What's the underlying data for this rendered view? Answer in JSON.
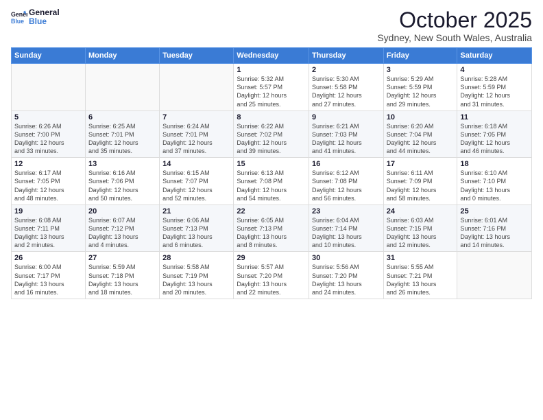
{
  "logo": {
    "line1": "General",
    "line2": "Blue"
  },
  "title": "October 2025",
  "subtitle": "Sydney, New South Wales, Australia",
  "days_of_week": [
    "Sunday",
    "Monday",
    "Tuesday",
    "Wednesday",
    "Thursday",
    "Friday",
    "Saturday"
  ],
  "weeks": [
    [
      {
        "day": "",
        "info": ""
      },
      {
        "day": "",
        "info": ""
      },
      {
        "day": "",
        "info": ""
      },
      {
        "day": "1",
        "info": "Sunrise: 5:32 AM\nSunset: 5:57 PM\nDaylight: 12 hours\nand 25 minutes."
      },
      {
        "day": "2",
        "info": "Sunrise: 5:30 AM\nSunset: 5:58 PM\nDaylight: 12 hours\nand 27 minutes."
      },
      {
        "day": "3",
        "info": "Sunrise: 5:29 AM\nSunset: 5:59 PM\nDaylight: 12 hours\nand 29 minutes."
      },
      {
        "day": "4",
        "info": "Sunrise: 5:28 AM\nSunset: 5:59 PM\nDaylight: 12 hours\nand 31 minutes."
      }
    ],
    [
      {
        "day": "5",
        "info": "Sunrise: 6:26 AM\nSunset: 7:00 PM\nDaylight: 12 hours\nand 33 minutes."
      },
      {
        "day": "6",
        "info": "Sunrise: 6:25 AM\nSunset: 7:01 PM\nDaylight: 12 hours\nand 35 minutes."
      },
      {
        "day": "7",
        "info": "Sunrise: 6:24 AM\nSunset: 7:01 PM\nDaylight: 12 hours\nand 37 minutes."
      },
      {
        "day": "8",
        "info": "Sunrise: 6:22 AM\nSunset: 7:02 PM\nDaylight: 12 hours\nand 39 minutes."
      },
      {
        "day": "9",
        "info": "Sunrise: 6:21 AM\nSunset: 7:03 PM\nDaylight: 12 hours\nand 41 minutes."
      },
      {
        "day": "10",
        "info": "Sunrise: 6:20 AM\nSunset: 7:04 PM\nDaylight: 12 hours\nand 44 minutes."
      },
      {
        "day": "11",
        "info": "Sunrise: 6:18 AM\nSunset: 7:05 PM\nDaylight: 12 hours\nand 46 minutes."
      }
    ],
    [
      {
        "day": "12",
        "info": "Sunrise: 6:17 AM\nSunset: 7:05 PM\nDaylight: 12 hours\nand 48 minutes."
      },
      {
        "day": "13",
        "info": "Sunrise: 6:16 AM\nSunset: 7:06 PM\nDaylight: 12 hours\nand 50 minutes."
      },
      {
        "day": "14",
        "info": "Sunrise: 6:15 AM\nSunset: 7:07 PM\nDaylight: 12 hours\nand 52 minutes."
      },
      {
        "day": "15",
        "info": "Sunrise: 6:13 AM\nSunset: 7:08 PM\nDaylight: 12 hours\nand 54 minutes."
      },
      {
        "day": "16",
        "info": "Sunrise: 6:12 AM\nSunset: 7:08 PM\nDaylight: 12 hours\nand 56 minutes."
      },
      {
        "day": "17",
        "info": "Sunrise: 6:11 AM\nSunset: 7:09 PM\nDaylight: 12 hours\nand 58 minutes."
      },
      {
        "day": "18",
        "info": "Sunrise: 6:10 AM\nSunset: 7:10 PM\nDaylight: 13 hours\nand 0 minutes."
      }
    ],
    [
      {
        "day": "19",
        "info": "Sunrise: 6:08 AM\nSunset: 7:11 PM\nDaylight: 13 hours\nand 2 minutes."
      },
      {
        "day": "20",
        "info": "Sunrise: 6:07 AM\nSunset: 7:12 PM\nDaylight: 13 hours\nand 4 minutes."
      },
      {
        "day": "21",
        "info": "Sunrise: 6:06 AM\nSunset: 7:13 PM\nDaylight: 13 hours\nand 6 minutes."
      },
      {
        "day": "22",
        "info": "Sunrise: 6:05 AM\nSunset: 7:13 PM\nDaylight: 13 hours\nand 8 minutes."
      },
      {
        "day": "23",
        "info": "Sunrise: 6:04 AM\nSunset: 7:14 PM\nDaylight: 13 hours\nand 10 minutes."
      },
      {
        "day": "24",
        "info": "Sunrise: 6:03 AM\nSunset: 7:15 PM\nDaylight: 13 hours\nand 12 minutes."
      },
      {
        "day": "25",
        "info": "Sunrise: 6:01 AM\nSunset: 7:16 PM\nDaylight: 13 hours\nand 14 minutes."
      }
    ],
    [
      {
        "day": "26",
        "info": "Sunrise: 6:00 AM\nSunset: 7:17 PM\nDaylight: 13 hours\nand 16 minutes."
      },
      {
        "day": "27",
        "info": "Sunrise: 5:59 AM\nSunset: 7:18 PM\nDaylight: 13 hours\nand 18 minutes."
      },
      {
        "day": "28",
        "info": "Sunrise: 5:58 AM\nSunset: 7:19 PM\nDaylight: 13 hours\nand 20 minutes."
      },
      {
        "day": "29",
        "info": "Sunrise: 5:57 AM\nSunset: 7:20 PM\nDaylight: 13 hours\nand 22 minutes."
      },
      {
        "day": "30",
        "info": "Sunrise: 5:56 AM\nSunset: 7:20 PM\nDaylight: 13 hours\nand 24 minutes."
      },
      {
        "day": "31",
        "info": "Sunrise: 5:55 AM\nSunset: 7:21 PM\nDaylight: 13 hours\nand 26 minutes."
      },
      {
        "day": "",
        "info": ""
      }
    ]
  ]
}
